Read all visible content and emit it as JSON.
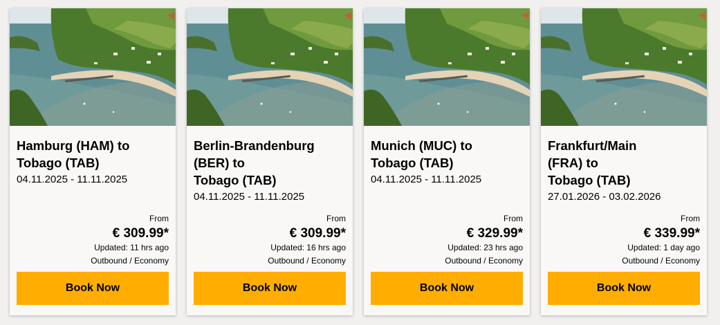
{
  "offers": [
    {
      "route_lines": [
        "Hamburg (HAM) to",
        "Tobago (TAB)"
      ],
      "dates": "04.11.2025 - 11.11.2025",
      "from_label": "From",
      "price": "€ 309.99*",
      "updated": "Updated: 11 hrs ago",
      "fare": "Outbound / Economy",
      "cta": "Book Now",
      "image": "tobago-beach-bay-photo"
    },
    {
      "route_lines": [
        "Berlin-Brandenburg",
        "(BER) to",
        "Tobago (TAB)"
      ],
      "dates": "04.11.2025 - 11.11.2025",
      "from_label": "From",
      "price": "€ 309.99*",
      "updated": "Updated: 16 hrs ago",
      "fare": "Outbound / Economy",
      "cta": "Book Now",
      "image": "tobago-beach-bay-photo"
    },
    {
      "route_lines": [
        "Munich (MUC) to",
        "Tobago (TAB)"
      ],
      "dates": "04.11.2025 - 11.11.2025",
      "from_label": "From",
      "price": "€ 329.99*",
      "updated": "Updated: 23 hrs ago",
      "fare": "Outbound / Economy",
      "cta": "Book Now",
      "image": "tobago-beach-bay-photo"
    },
    {
      "route_lines": [
        "Frankfurt/Main",
        "(FRA) to",
        "Tobago (TAB)"
      ],
      "dates": "27.01.2026 - 03.02.2026",
      "from_label": "From",
      "price": "€ 339.99*",
      "updated": "Updated: 1 day ago",
      "fare": "Outbound / Economy",
      "cta": "Book Now",
      "image": "tobago-beach-bay-photo"
    }
  ],
  "colors": {
    "cta_background": "#ffad00",
    "card_background": "#f9f8f7",
    "page_background": "#f1f0ef"
  }
}
